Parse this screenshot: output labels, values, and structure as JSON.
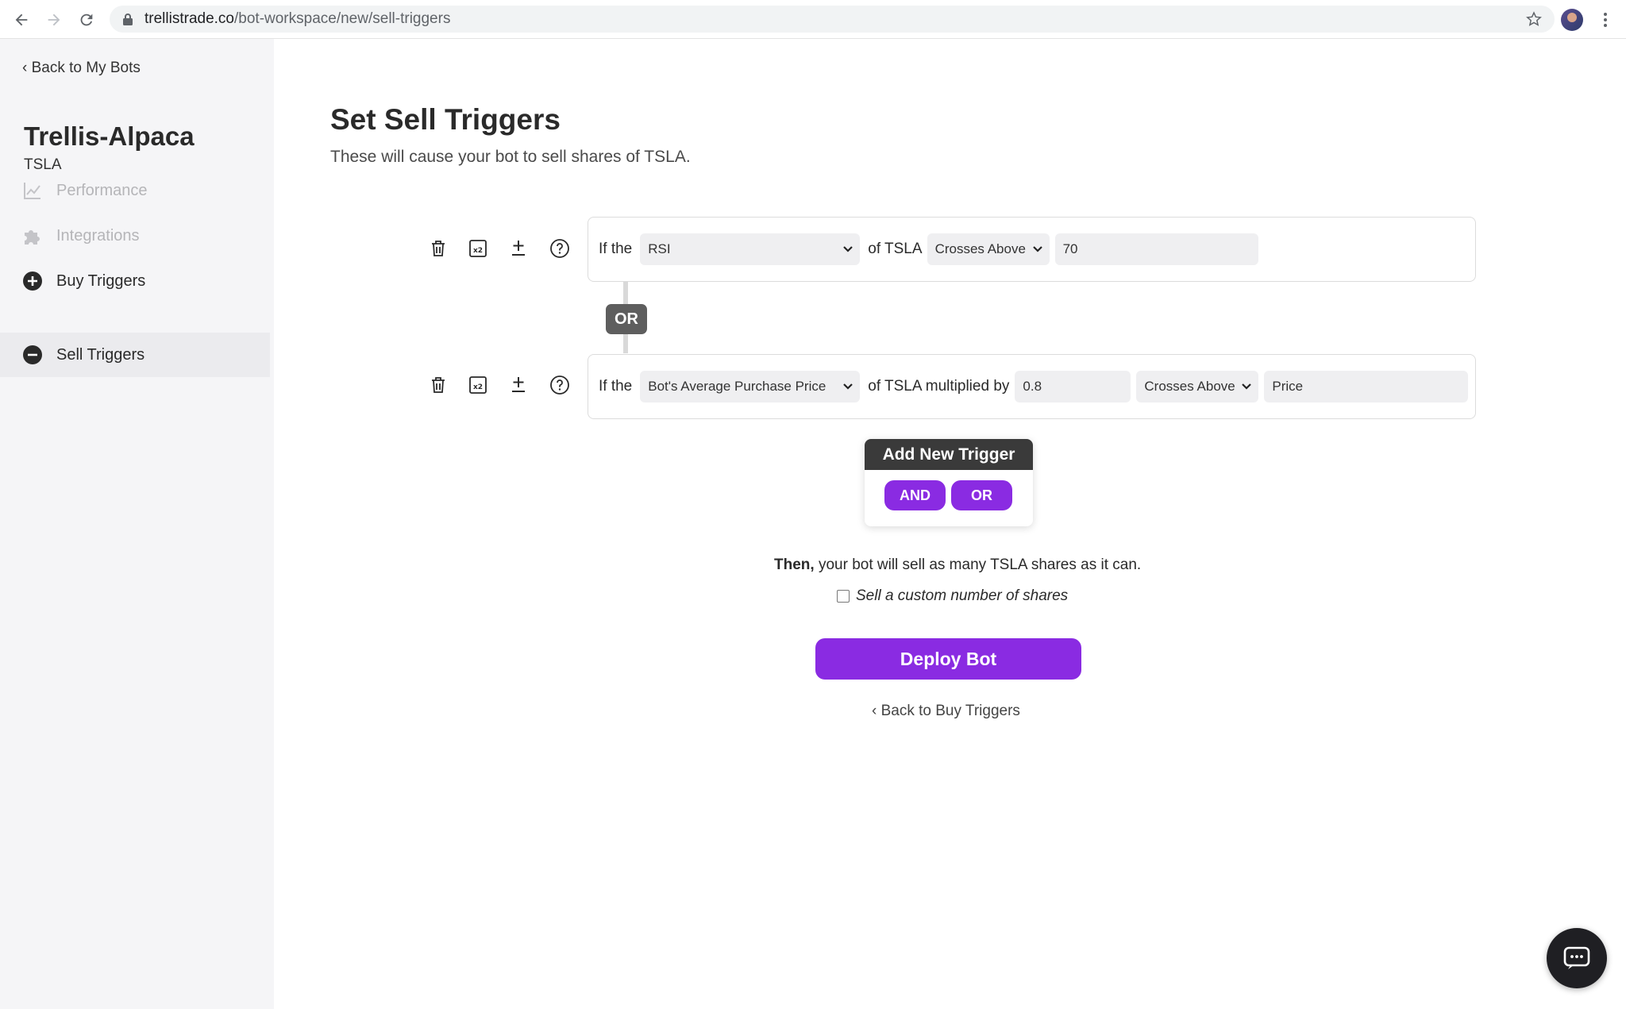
{
  "browser": {
    "url_host": "trellistrade.co",
    "url_path": "/bot-workspace/new/sell-triggers"
  },
  "sidebar": {
    "back_label": "‹ Back to My Bots",
    "bot_name": "Trellis-Alpaca",
    "ticker": "TSLA",
    "items": [
      {
        "label": "Performance",
        "icon": "chart-line-icon",
        "state": "disabled"
      },
      {
        "label": "Integrations",
        "icon": "puzzle-icon",
        "state": "disabled"
      },
      {
        "label": "Buy Triggers",
        "icon": "plus-circle-icon",
        "state": "enabled"
      },
      {
        "label": "Sell Triggers",
        "icon": "minus-circle-icon",
        "state": "active"
      }
    ]
  },
  "main": {
    "title": "Set Sell Triggers",
    "subtitle": "These will cause your bot to sell shares of TSLA."
  },
  "triggers": [
    {
      "prefix": "If the",
      "indicator": "RSI",
      "of_text": "of TSLA",
      "condition": "Crosses Above",
      "value": "70"
    },
    {
      "prefix": "If the",
      "indicator": "Bot's Average Purchase Price",
      "of_text": "of TSLA multiplied by",
      "multiplier": "0.8",
      "condition": "Crosses Above",
      "target": "Price"
    }
  ],
  "connector_label": "OR",
  "add_trigger": {
    "title": "Add New Trigger",
    "and_label": "AND",
    "or_label": "OR"
  },
  "then": {
    "bold": "Then,",
    "rest": " your bot will sell as many TSLA shares as it can."
  },
  "custom_shares_label": "Sell a custom number of shares",
  "deploy_label": "Deploy Bot",
  "back_buy_label": "‹ Back to Buy Triggers",
  "colors": {
    "accent": "#8a2be2",
    "sidebar_bg": "#f5f5f7",
    "dark_badge": "#5e5e5e"
  }
}
